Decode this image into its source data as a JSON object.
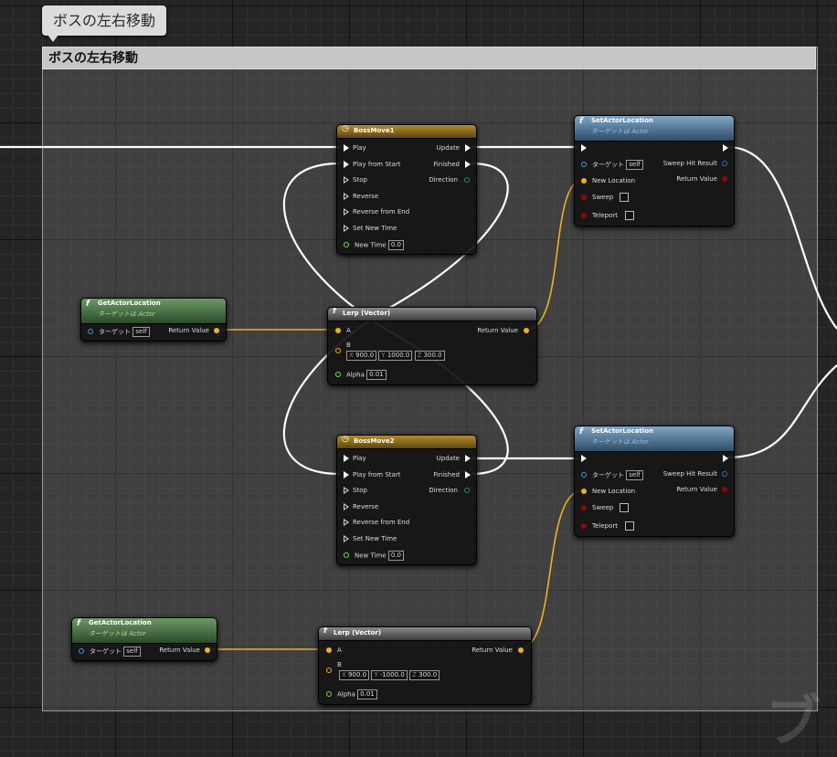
{
  "comment": {
    "bubble_text": "ボスの左右移動",
    "header_text": "ボスの左右移動"
  },
  "colors": {
    "exec_wire": "#ffffff",
    "vector_wire": "#f0b020",
    "timeline_header": "#b58d2a",
    "function_header": "#5c84a8",
    "pure_header": "#5c8a55"
  },
  "icons": {
    "timeline": "clock-icon",
    "function": "function-f-icon",
    "exec": "exec-arrow-icon"
  },
  "bossmove1": {
    "title": "BossMove1",
    "inputs": [
      "Play",
      "Play from Start",
      "Stop",
      "Reverse",
      "Reverse from End",
      "Set New Time",
      "New Time"
    ],
    "new_time": "0.0",
    "outputs": [
      "Update",
      "Finished",
      "Direction"
    ]
  },
  "bossmove2": {
    "title": "BossMove2",
    "inputs": [
      "Play",
      "Play from Start",
      "Stop",
      "Reverse",
      "Reverse from End",
      "Set New Time",
      "New Time"
    ],
    "new_time": "0.0",
    "outputs": [
      "Update",
      "Finished",
      "Direction"
    ]
  },
  "setloc1": {
    "title": "SetActorLocation",
    "subtitle": "ターゲットは Actor",
    "target": "ターゲット",
    "self": "self",
    "new_location": "New Location",
    "sweep": "Sweep",
    "teleport": "Teleport",
    "sweep_hit": "Sweep Hit Result",
    "return_value": "Return Value"
  },
  "setloc2": {
    "title": "SetActorLocation",
    "subtitle": "ターゲットは Actor",
    "target": "ターゲット",
    "self": "self",
    "new_location": "New Location",
    "sweep": "Sweep",
    "teleport": "Teleport",
    "sweep_hit": "Sweep Hit Result",
    "return_value": "Return Value"
  },
  "getloc1": {
    "title": "GetActorLocation",
    "subtitle": "ターゲットは Actor",
    "target": "ターゲット",
    "self": "self",
    "return_value": "Return Value"
  },
  "getloc2": {
    "title": "GetActorLocation",
    "subtitle": "ターゲットは Actor",
    "target": "ターゲット",
    "self": "self",
    "return_value": "Return Value"
  },
  "lerp1": {
    "title": "Lerp (Vector)",
    "a": "A",
    "b": "B",
    "alpha": "Alpha",
    "alpha_value": "0.01",
    "return_value": "Return Value",
    "x_label": "X",
    "x": "900.0",
    "y_label": "Y",
    "y": "1000.0",
    "z_label": "Z",
    "z": "300.0"
  },
  "lerp2": {
    "title": "Lerp (Vector)",
    "a": "A",
    "b": "B",
    "alpha": "Alpha",
    "alpha_value": "0.01",
    "return_value": "Return Value",
    "x_label": "X",
    "x": "900.0",
    "y_label": "Y",
    "y": "-1000.0",
    "z_label": "Z",
    "z": "300.0"
  }
}
